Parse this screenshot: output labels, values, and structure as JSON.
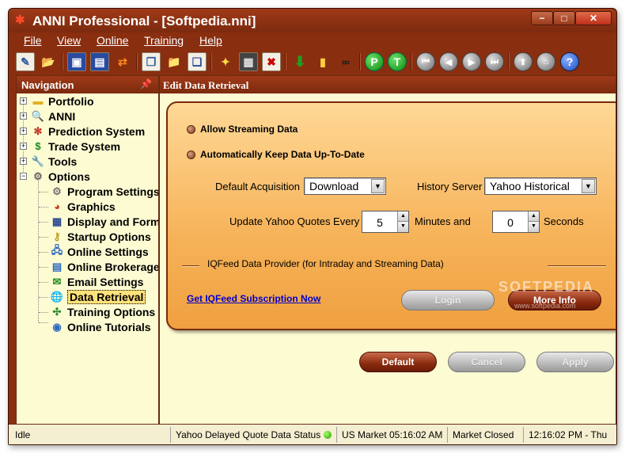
{
  "window": {
    "title": "ANNI Professional - [Softpedia.nni]"
  },
  "menu": [
    "File",
    "View",
    "Online",
    "Training",
    "Help"
  ],
  "toolbar": {
    "buttons": [
      "new-doc",
      "open-folder",
      "save",
      "save-as",
      "refresh-exchange",
      "copy",
      "open",
      "stack",
      "sparkle",
      "grid",
      "delete",
      "download",
      "chart-bars",
      "binoculars",
      "P",
      "T",
      "first",
      "prev",
      "next",
      "last",
      "back-arrow",
      "home",
      "help"
    ]
  },
  "navigation": {
    "title": "Navigation",
    "items": [
      {
        "label": "Portfolio",
        "icon": "folder-icon",
        "expander": "+"
      },
      {
        "label": "ANNI",
        "icon": "magnifier-icon",
        "expander": "+"
      },
      {
        "label": "Prediction System",
        "icon": "network-icon",
        "expander": "+"
      },
      {
        "label": "Trade System",
        "icon": "dollar-icon",
        "expander": "+"
      },
      {
        "label": "Tools",
        "icon": "wrench-icon",
        "expander": "+"
      },
      {
        "label": "Options",
        "icon": "options-icon",
        "expander": "−"
      },
      {
        "label": "Program Settings",
        "icon": "gear-icon"
      },
      {
        "label": "Graphics",
        "icon": "palette-icon"
      },
      {
        "label": "Display and Form",
        "icon": "table-icon"
      },
      {
        "label": "Startup Options",
        "icon": "key-icon"
      },
      {
        "label": "Online Settings",
        "icon": "network-pc-icon"
      },
      {
        "label": "Online Brokerage",
        "icon": "broker-icon"
      },
      {
        "label": "Email Settings",
        "icon": "email-icon"
      },
      {
        "label": "Data Retrieval",
        "icon": "globe-icon",
        "selected": true
      },
      {
        "label": "Training Options |",
        "icon": "training-icon"
      },
      {
        "label": "Online Tutorials",
        "icon": "tutorial-icon"
      }
    ]
  },
  "panel": {
    "title": "Edit Data Retrieval",
    "allow_streaming": "Allow Streaming Data",
    "auto_keep": "Automatically Keep Data Up-To-Date",
    "default_acq_label": "Default Acquisition",
    "default_acq_value": "Download",
    "history_server_label": "History Server",
    "history_server_value": "Yahoo Historical",
    "update_label": "Update Yahoo Quotes Every",
    "minutes_value": "5",
    "minutes_label": "Minutes and",
    "seconds_value": "0",
    "seconds_label": "Seconds",
    "iqfeed_label": "IQFeed Data Provider (for Intraday and Streaming Data)",
    "subscription_link": "Get IQFeed Subscription Now",
    "login": "Login",
    "more_info": "More Info",
    "watermark": "SOFTPEDIA",
    "watermark_sub": "www.softpedia.com"
  },
  "buttons": {
    "default": "Default",
    "cancel": "Cancel",
    "apply": "Apply"
  },
  "status": {
    "state": "Idle",
    "quote_status": "Yahoo Delayed Quote Data Status",
    "market_time": "US Market 05:16:02 AM",
    "market_state": "Market Closed",
    "clock": "12:16:02 PM - Thu"
  },
  "colors": {
    "frame": "#8a2e10",
    "panel_bg": "#fdfbd2",
    "orange": "#f6b258",
    "selected": "#ffe27a"
  }
}
